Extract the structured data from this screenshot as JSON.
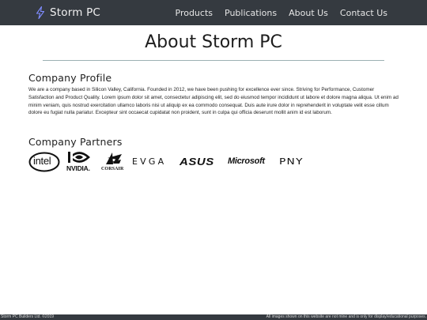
{
  "nav": {
    "brand": "Storm PC",
    "brand_icon": "lightning-bolt-icon",
    "links": [
      "Products",
      "Publications",
      "About Us",
      "Contact Us"
    ]
  },
  "main": {
    "title": "About Storm PC",
    "profile": {
      "heading": "Company Profile",
      "text": "We are a company based in Silicon Valley, California. Founded in 2012, we have been pushing for excellence ever since. Striving for Performance, Customer Satisfaction and Product Quality. Lorem ipsum dolor sit amet, consectetur adipiscing elit, sed do eiusmod tempor incididunt ut labore et dolore magna aliqua. Ut enim ad minim veniam, quis nostrud exercitation ullamco laboris nisi ut aliquip ex ea commodo consequat. Duis aute irure dolor in reprehenderit in voluptate velit esse cillum dolore eu fugiat nulla pariatur. Excepteur sint occaecat cupidatat non proident, sunt in culpa qui officia deserunt mollit anim id est laborum."
    },
    "partners": {
      "heading": "Company Partners",
      "logos": {
        "intel": "intel",
        "nvidia": "NVIDIA.",
        "corsair": "CORSAIR",
        "evga": "EVGA",
        "asus": "ASUS",
        "microsoft": "Microsoft",
        "pny": "PNY"
      }
    }
  },
  "footer": {
    "left": "Storm PC Builders Ltd. ©2019",
    "right": "All images shown on this website are not mine and is only for display/educational purposes."
  },
  "colors": {
    "navbar": "#353a40",
    "bolt": "#7f8cff",
    "rule": "#9cb0b3"
  }
}
